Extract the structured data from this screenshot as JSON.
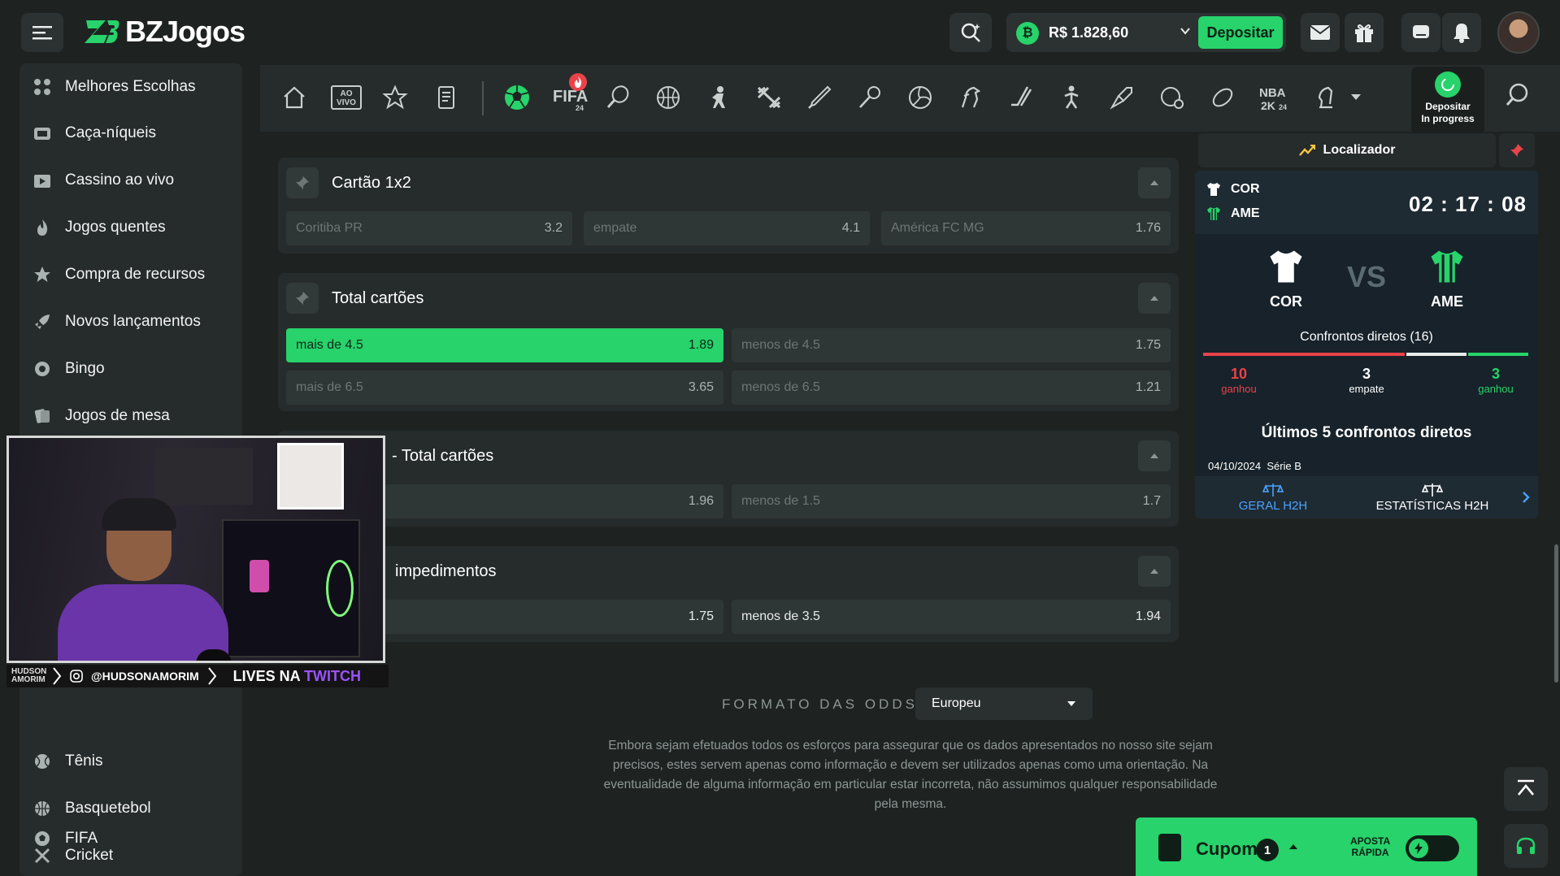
{
  "header": {
    "brand": "BZJogos",
    "balance": "R$ 1.828,60",
    "deposit_label": "Depositar"
  },
  "sidebar": {
    "items": [
      {
        "label": "Melhores Escolhas",
        "icon": "grid-icon"
      },
      {
        "label": "Caça-níqueis",
        "icon": "slot-icon"
      },
      {
        "label": "Cassino ao vivo",
        "icon": "live-casino-icon"
      },
      {
        "label": "Jogos quentes",
        "icon": "flame-icon"
      },
      {
        "label": "Compra de recursos",
        "icon": "star-icon"
      },
      {
        "label": "Novos lançamentos",
        "icon": "rocket-icon"
      },
      {
        "label": "Bingo",
        "icon": "bingo-icon"
      },
      {
        "label": "Jogos de mesa",
        "icon": "table-games-icon"
      },
      {
        "label": "Tênis",
        "icon": "tennis-icon"
      },
      {
        "label": "Basquetebol",
        "icon": "basketball-icon"
      },
      {
        "label": "Cricket",
        "icon": "cricket-icon"
      },
      {
        "label": "FIFA",
        "icon": "soccer-ball-icon"
      }
    ]
  },
  "sports_nav": {
    "ao_vivo": "AO VIVO",
    "fifa": "FIFA",
    "nba": "NBA",
    "deposit_progress": [
      "Depositar",
      "In progress"
    ]
  },
  "markets": [
    {
      "title": "Cartão 1x2",
      "odds": [
        {
          "label": "Coritiba PR",
          "value": "3.2"
        },
        {
          "label": "empate",
          "value": "4.1"
        },
        {
          "label": "América FC MG",
          "value": "1.76"
        }
      ]
    },
    {
      "title": "Total cartões",
      "odds": [
        {
          "label": "mais de 4.5",
          "value": "1.89",
          "selected": true
        },
        {
          "label": "menos de 4.5",
          "value": "1.75"
        },
        {
          "label": "mais de 6.5",
          "value": "3.65"
        },
        {
          "label": "menos de 6.5",
          "value": "1.21"
        }
      ]
    },
    {
      "title": "- Total cartões",
      "odds": [
        {
          "label": "",
          "value": "1.96"
        },
        {
          "label": "menos de 1.5",
          "value": "1.7"
        }
      ]
    },
    {
      "title": "impedimentos",
      "odds": [
        {
          "label": "",
          "value": "1.75"
        },
        {
          "label": "menos de 3.5",
          "value": "1.94"
        }
      ]
    }
  ],
  "odds_format": {
    "label": "FORMATO DAS ODDS",
    "selected": "Europeu"
  },
  "disclaimer": "Embora sejam efetuados todos os esforços para assegurar que os dados apresentados no nosso site sejam precisos, estes servem apenas como informação e devem ser utilizados apenas como uma orientação. Na eventualidade de alguma informação em particular estar incorreta, não assumimos qualquer responsabilidade pela mesma.",
  "match": {
    "locator_label": "Localizador",
    "home": "COR",
    "away": "AME",
    "clock": "02 : 17 : 08",
    "vs": "VS",
    "direct_title": "Confrontos diretos (16)",
    "stats": {
      "home_wins": "10",
      "home_wins_label": "ganhou",
      "draws": "3",
      "draws_label": "empate",
      "away_wins": "3",
      "away_wins_label": "ganhou"
    },
    "last5_title": "Últimos 5 confrontos diretos",
    "last_match_date": "04/10/2024",
    "last_match_league": "Série B",
    "tabs": [
      "GERAL H2H",
      "ESTATÍSTICAS H2H"
    ]
  },
  "stream_banner": {
    "tag": "HUDSON AMORIM",
    "handle": "@HUDSONAMORIM",
    "lives": "LIVES NA",
    "twitch": "TWITCH"
  },
  "cupom": {
    "label": "Cupom",
    "count": "1",
    "quick_bet": [
      "APOSTA",
      "RÁPIDA"
    ]
  },
  "colors": {
    "accent": "#27d36a",
    "danger": "#e9434a",
    "background": "#1e2322",
    "panel": "#262c2b"
  }
}
